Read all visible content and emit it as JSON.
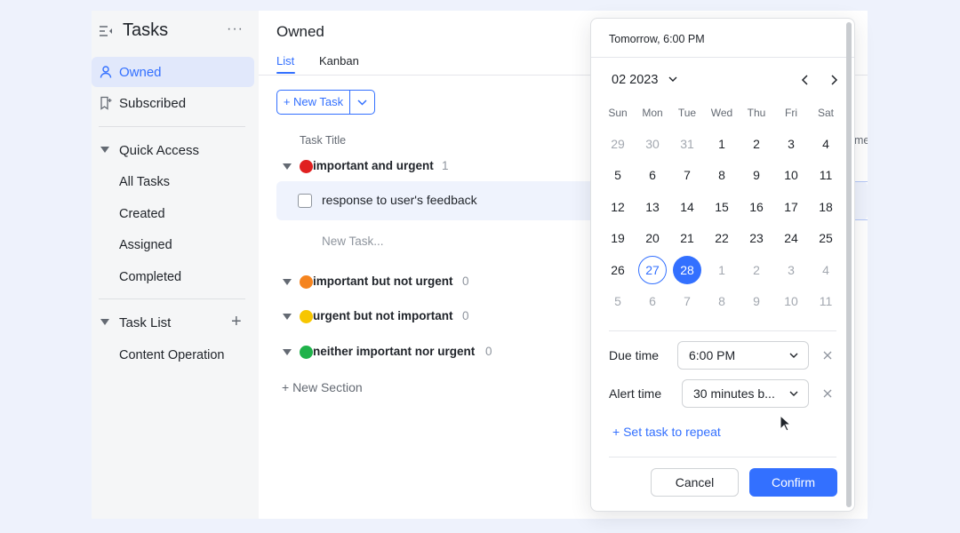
{
  "sidebar": {
    "title": "Tasks",
    "more": "···",
    "items": [
      {
        "label": "Owned",
        "icon": "user-icon"
      },
      {
        "label": "Subscribed",
        "icon": "subscribe-icon"
      }
    ],
    "quick_access": {
      "label": "Quick Access",
      "items": [
        "All Tasks",
        "Created",
        "Assigned",
        "Completed"
      ]
    },
    "task_list": {
      "label": "Task List",
      "items": [
        "Content Operation"
      ]
    }
  },
  "main": {
    "title": "Owned",
    "tabs": [
      "List",
      "Kanban"
    ],
    "new_task_button": "+ New Task",
    "column_title": "Task Title",
    "column_extra": "me",
    "sections": [
      {
        "label": "important and urgent",
        "count": "1",
        "color": "#e02020"
      },
      {
        "label": "important but not urgent",
        "count": "0",
        "color": "#f5841f"
      },
      {
        "label": "urgent but not important",
        "count": "0",
        "color": "#f7c600"
      },
      {
        "label": "neither important nor urgent",
        "count": "0",
        "color": "#1fb24a"
      }
    ],
    "task": "response to user's feedback",
    "new_task_placeholder": "New Task...",
    "new_section": "+ New Section"
  },
  "popup": {
    "header": "Tomorrow, 6:00 PM",
    "month": "02 2023",
    "weekdays": [
      "Sun",
      "Mon",
      "Tue",
      "Wed",
      "Thu",
      "Fri",
      "Sat"
    ],
    "weeks": [
      [
        "29",
        "30",
        "31",
        "1",
        "2",
        "3",
        "4"
      ],
      [
        "5",
        "6",
        "7",
        "8",
        "9",
        "10",
        "11"
      ],
      [
        "12",
        "13",
        "14",
        "15",
        "16",
        "17",
        "18"
      ],
      [
        "19",
        "20",
        "21",
        "22",
        "23",
        "24",
        "25"
      ],
      [
        "26",
        "27",
        "28",
        "1",
        "2",
        "3",
        "4"
      ],
      [
        "5",
        "6",
        "7",
        "8",
        "9",
        "10",
        "11"
      ]
    ],
    "today": "27",
    "selected": "28",
    "due_time_label": "Due time",
    "due_time_value": "6:00 PM",
    "alert_time_label": "Alert time",
    "alert_time_value": "30 minutes b...",
    "repeat_label": "+ Set task to repeat",
    "cancel": "Cancel",
    "confirm": "Confirm",
    "accent": "#3370ff"
  }
}
